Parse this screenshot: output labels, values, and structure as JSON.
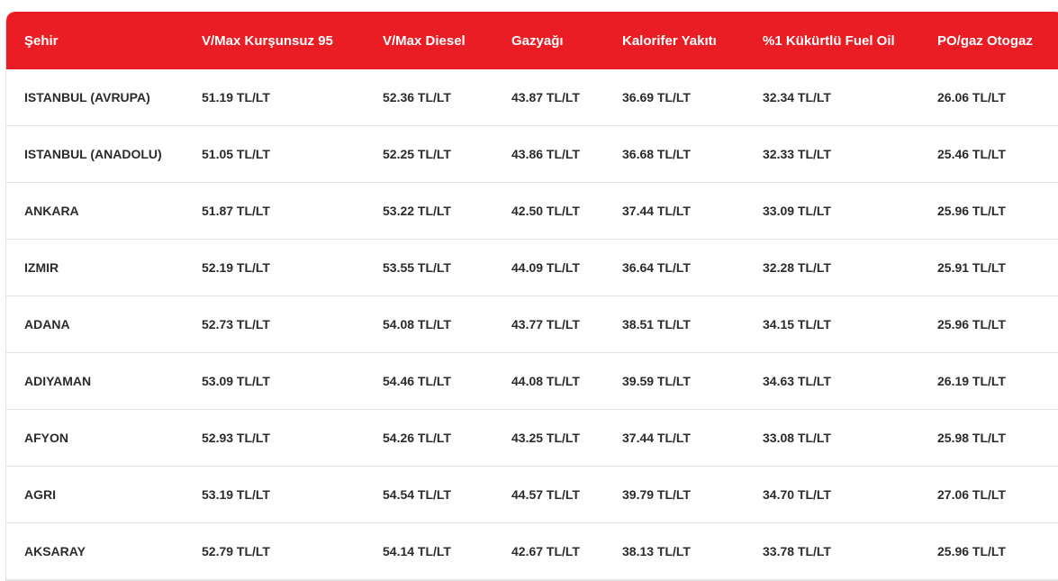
{
  "header": {
    "accent_color": "#ea1c24",
    "columns": [
      "Şehir",
      "V/Max Kurşunsuz 95",
      "V/Max Diesel",
      "Gazyağı",
      "Kalorifer Yakıtı",
      "%1 Kükürtlü Fuel Oil",
      "PO/gaz Otogaz"
    ]
  },
  "rows": [
    [
      "ISTANBUL (AVRUPA)",
      "51.19 TL/LT",
      "52.36 TL/LT",
      "43.87 TL/LT",
      "36.69 TL/LT",
      "32.34 TL/LT",
      "26.06 TL/LT"
    ],
    [
      "ISTANBUL (ANADOLU)",
      "51.05 TL/LT",
      "52.25 TL/LT",
      "43.86 TL/LT",
      "36.68 TL/LT",
      "32.33 TL/LT",
      "25.46 TL/LT"
    ],
    [
      "ANKARA",
      "51.87 TL/LT",
      "53.22 TL/LT",
      "42.50 TL/LT",
      "37.44 TL/LT",
      "33.09 TL/LT",
      "25.96 TL/LT"
    ],
    [
      "IZMIR",
      "52.19 TL/LT",
      "53.55 TL/LT",
      "44.09 TL/LT",
      "36.64 TL/LT",
      "32.28 TL/LT",
      "25.91 TL/LT"
    ],
    [
      "ADANA",
      "52.73 TL/LT",
      "54.08 TL/LT",
      "43.77 TL/LT",
      "38.51 TL/LT",
      "34.15 TL/LT",
      "25.96 TL/LT"
    ],
    [
      "ADIYAMAN",
      "53.09 TL/LT",
      "54.46 TL/LT",
      "44.08 TL/LT",
      "39.59 TL/LT",
      "34.63 TL/LT",
      "26.19 TL/LT"
    ],
    [
      "AFYON",
      "52.93 TL/LT",
      "54.26 TL/LT",
      "43.25 TL/LT",
      "37.44 TL/LT",
      "33.08 TL/LT",
      "25.98 TL/LT"
    ],
    [
      "AGRI",
      "53.19 TL/LT",
      "54.54 TL/LT",
      "44.57 TL/LT",
      "39.79 TL/LT",
      "34.70 TL/LT",
      "27.06 TL/LT"
    ],
    [
      "AKSARAY",
      "52.79 TL/LT",
      "54.14 TL/LT",
      "42.67 TL/LT",
      "38.13 TL/LT",
      "33.78 TL/LT",
      "25.96 TL/LT"
    ]
  ]
}
